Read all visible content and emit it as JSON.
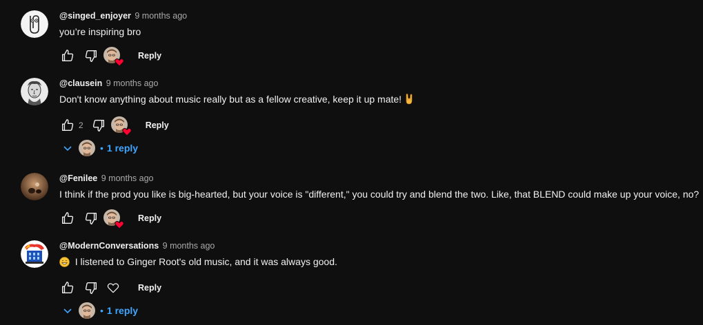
{
  "comments": [
    {
      "author": "@singed_enjoyer",
      "time": "9 months ago",
      "text": "you’re inspiring bro",
      "likes": "",
      "creator_heart": true,
      "reply_label": "Reply"
    },
    {
      "author": "@clausein",
      "time": "9 months ago",
      "text": "Don't know anything about music really but as a fellow creative, keep it up mate!",
      "text_emoji": "rock-on-hand-emoji",
      "likes": "2",
      "creator_heart": true,
      "reply_label": "Reply",
      "replies_label": "1 reply"
    },
    {
      "author": "@Fenilee",
      "time": "9 months ago",
      "text": "I think if the prod you like is big-hearted, but your voice is \"different,\" you could try and blend the two. Like, that BLEND could make up your voice, no?",
      "likes": "",
      "creator_heart": true,
      "reply_label": "Reply"
    },
    {
      "author": "@ModernConversations",
      "time": "9 months ago",
      "text": "I listened to Ginger Root's old music, and it was always good.",
      "text_emoji": "grinning-face-emoji",
      "likes": "",
      "creator_heart": false,
      "reply_label": "Reply",
      "replies_label": "1 reply"
    }
  ],
  "icons": {
    "like": "thumb-up-icon",
    "dislike": "thumb-down-icon",
    "heart": "heart-icon",
    "chevron": "chevron-down-icon"
  },
  "colors": {
    "background": "#0f0f0f",
    "text": "#f1f1f1",
    "muted": "#aaaaaa",
    "link": "#3ea6ff",
    "heart": "#ff0033"
  }
}
